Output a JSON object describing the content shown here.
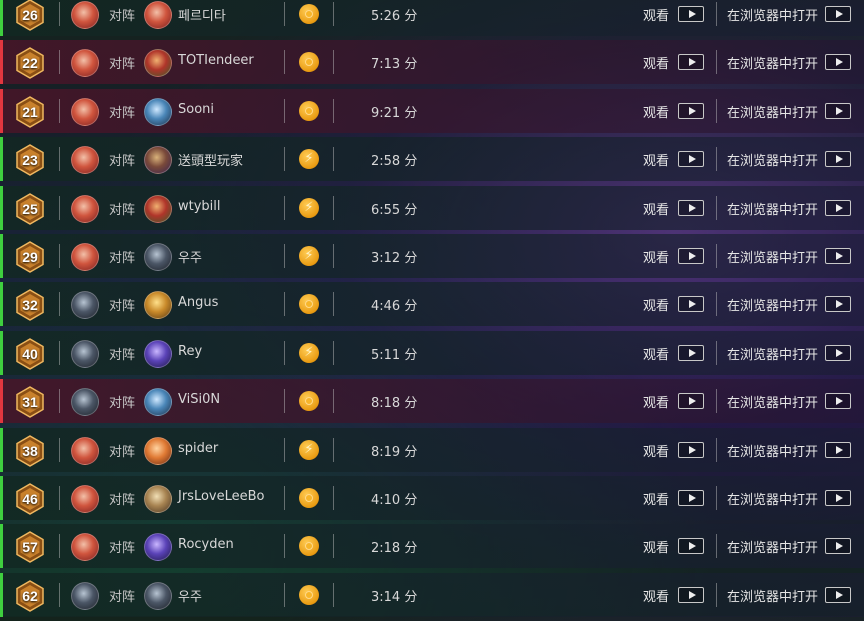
{
  "labels": {
    "vs": "对阵",
    "watch": "观看",
    "open_in_browser": "在浏览器中打开",
    "minute_unit": "分"
  },
  "colors": {
    "win": "#3fcf3f",
    "loss": "#e2373f",
    "badge_gold": "#c9812c",
    "mode_gold": "#e99b12"
  },
  "games": [
    {
      "rank": "26",
      "result": "win",
      "opponent": "페르디타",
      "duration": "5:26 分",
      "mode_icon": "gold-coin-icon",
      "player_avatar": "red-hero",
      "opponent_avatar": "red-hero"
    },
    {
      "rank": "22",
      "result": "loss",
      "opponent": "TOTIendeer",
      "duration": "7:13 分",
      "mode_icon": "gold-coin-icon",
      "player_avatar": "red-hero",
      "opponent_avatar": "red-green-hero"
    },
    {
      "rank": "21",
      "result": "loss",
      "opponent": "Sooni",
      "duration": "9:21 分",
      "mode_icon": "gold-coin-icon",
      "player_avatar": "red-hero",
      "opponent_avatar": "blue-hero"
    },
    {
      "rank": "23",
      "result": "win",
      "opponent": "送頭型玩家",
      "duration": "2:58 分",
      "mode_icon": "wild-bolt-icon",
      "player_avatar": "red-hero",
      "opponent_avatar": "purple-hero"
    },
    {
      "rank": "25",
      "result": "win",
      "opponent": "wtybill",
      "duration": "6:55 分",
      "mode_icon": "wild-bolt-icon",
      "player_avatar": "red-hero",
      "opponent_avatar": "red-green-hero"
    },
    {
      "rank": "29",
      "result": "win",
      "opponent": "우주",
      "duration": "3:12 分",
      "mode_icon": "wild-bolt-icon",
      "player_avatar": "red-hero",
      "opponent_avatar": "dark-hero"
    },
    {
      "rank": "32",
      "result": "win",
      "opponent": "Angus",
      "duration": "4:46 分",
      "mode_icon": "gold-coin-icon",
      "player_avatar": "dark-hero",
      "opponent_avatar": "gold-hero"
    },
    {
      "rank": "40",
      "result": "win",
      "opponent": "Rey",
      "duration": "5:11 分",
      "mode_icon": "wild-bolt-icon",
      "player_avatar": "dark-hero",
      "opponent_avatar": "violet-hero"
    },
    {
      "rank": "31",
      "result": "loss",
      "opponent": "ViSi0N",
      "duration": "8:18 分",
      "mode_icon": "gold-coin-icon",
      "player_avatar": "dark-hero",
      "opponent_avatar": "blue-hero"
    },
    {
      "rank": "38",
      "result": "win",
      "opponent": "spider",
      "duration": "8:19 分",
      "mode_icon": "wild-bolt-icon",
      "player_avatar": "red-hero",
      "opponent_avatar": "orange-hero"
    },
    {
      "rank": "46",
      "result": "win",
      "opponent": "JrsLoveLeeBo",
      "duration": "4:10 分",
      "mode_icon": "gold-coin-icon",
      "player_avatar": "red-hero",
      "opponent_avatar": "tan-hero"
    },
    {
      "rank": "57",
      "result": "win",
      "opponent": "Rocyden",
      "duration": "2:18 分",
      "mode_icon": "gold-coin-icon",
      "player_avatar": "red-hero",
      "opponent_avatar": "violet-hero"
    },
    {
      "rank": "62",
      "result": "win",
      "opponent": "우주",
      "duration": "3:14 分",
      "mode_icon": "gold-coin-icon",
      "player_avatar": "dark-hero",
      "opponent_avatar": "dark-hero"
    }
  ]
}
